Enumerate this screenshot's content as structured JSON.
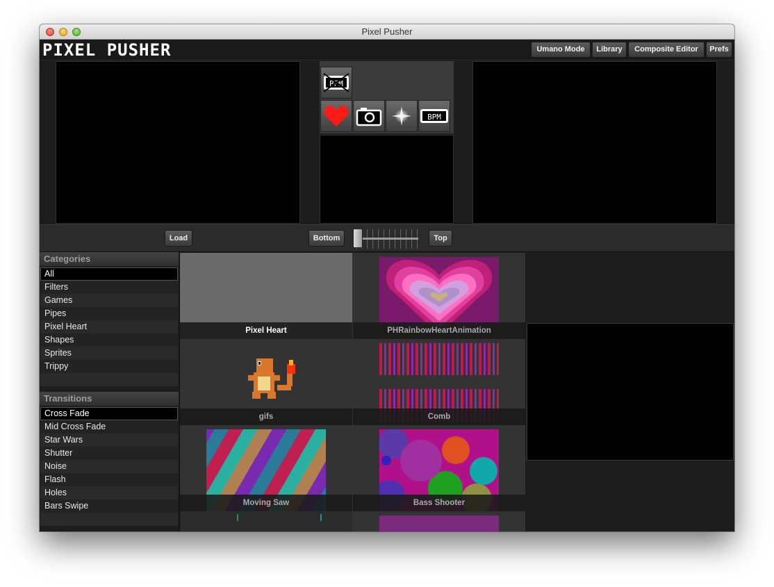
{
  "window": {
    "title": "Pixel Pusher"
  },
  "app": {
    "logo": "PIXEL PUSHER"
  },
  "nav": [
    {
      "label": "Umano Mode"
    },
    {
      "label": "Library"
    },
    {
      "label": "Composite Editor"
    },
    {
      "label": "Prefs"
    }
  ],
  "effects": [
    {
      "icon": "bpm-icon",
      "label": "BPM"
    },
    {
      "icon": "heart-icon",
      "color": "#ff1a1a"
    },
    {
      "icon": "camera-icon"
    },
    {
      "icon": "sparkle-icon"
    },
    {
      "icon": "bpm-icon",
      "label": "BPM"
    }
  ],
  "controls": {
    "load": "Load",
    "bottom": "Bottom",
    "top": "Top"
  },
  "categories": {
    "header": "Categories",
    "items": [
      "All",
      "Filters",
      "Games",
      "Pipes",
      "Pixel Heart",
      "Shapes",
      "Sprites",
      "Trippy"
    ],
    "selected": "All"
  },
  "transitions": {
    "header": "Transitions",
    "items": [
      "Cross Fade",
      "Mid Cross Fade",
      "Star Wars",
      "Shutter",
      "Noise",
      "Flash",
      "Holes",
      "Bars Swipe"
    ],
    "selected": "Cross Fade"
  },
  "library": [
    {
      "name": "Pixel Heart",
      "active": true
    },
    {
      "name": "PHRainbowHeartAnimation"
    },
    {
      "name": "gifs"
    },
    {
      "name": "Comb"
    },
    {
      "name": "Moving Saw"
    },
    {
      "name": "Bass Shooter"
    }
  ],
  "colors": {
    "accent_heart": "#ff1a1a",
    "window_bg": "#1d1d1d"
  }
}
